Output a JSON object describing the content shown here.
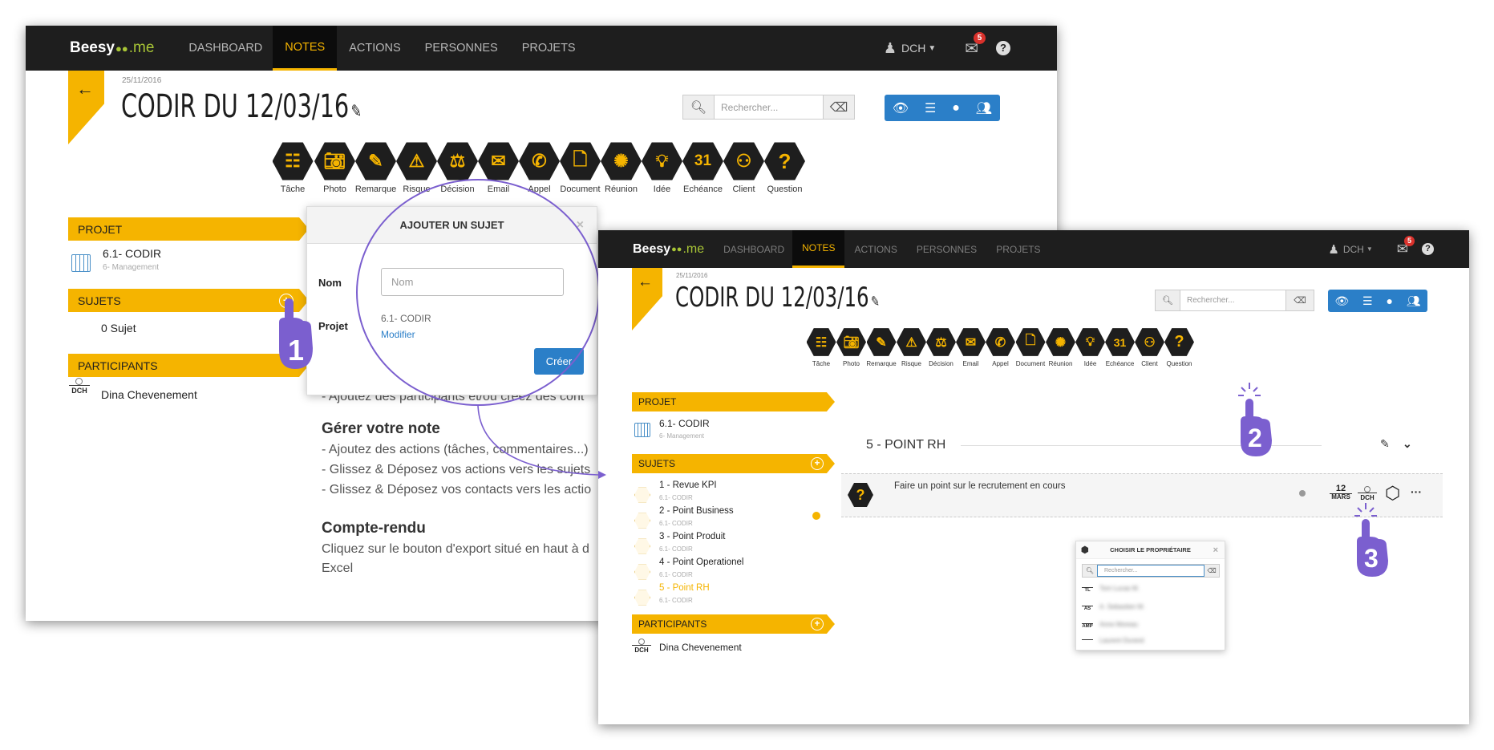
{
  "window1": {
    "logo": {
      "brand": "Beesy",
      "dots": "●●",
      "suffix": ".me"
    },
    "nav": [
      "DASHBOARD",
      "NOTES",
      "ACTIONS",
      "PERSONNES",
      "PROJETS"
    ],
    "active_nav": "NOTES",
    "user": "DCH",
    "mail_badge": "5",
    "date": "25/11/2016",
    "title": "CODIR DU 12/03/16",
    "search_placeholder": "Rechercher...",
    "tools": [
      "Tâche",
      "Photo",
      "Remarque",
      "Risque",
      "Décision",
      "Email",
      "Appel",
      "Document",
      "Réunion",
      "Idée",
      "Echéance",
      "Client",
      "Question"
    ],
    "sidebar": {
      "projet_header": "PROJET",
      "project_name": "6.1- CODIR",
      "project_sub": "6- Management",
      "sujets_header": "SUJETS",
      "sujets_count": "0 Sujet",
      "participants_header": "PARTICIPANTS",
      "participant_initials": "DCH",
      "participant_name": "Dina Chevenement"
    },
    "modal": {
      "title": "AJOUTER UN SUJET",
      "nom_label": "Nom",
      "nom_placeholder": "Nom",
      "projet_label": "Projet",
      "projet_value": "6.1- CODIR",
      "modifier": "Modifier",
      "creer": "Créer"
    },
    "help": {
      "line0": "- Ajoutez des participants et/ou créez des cont",
      "gerer_title": "Gérer votre note",
      "gerer_lines": [
        "- Ajoutez des actions (tâches, commentaires...)",
        "- Glissez & Déposez vos actions vers les sujets",
        "- Glissez & Déposez vos contacts vers les actio"
      ],
      "compte_title": "Compte-rendu",
      "compte_lines": [
        "Cliquez sur le bouton d'export situé en haut à d",
        "Excel"
      ]
    },
    "step": "1"
  },
  "window2": {
    "logo": {
      "brand": "Beesy",
      "dots": "●●",
      "suffix": ".me"
    },
    "nav": [
      "DASHBOARD",
      "NOTES",
      "ACTIONS",
      "PERSONNES",
      "PROJETS"
    ],
    "user": "DCH",
    "mail_badge": "5",
    "date": "25/11/2016",
    "title": "CODIR DU 12/03/16",
    "search_placeholder": "Rechercher...",
    "tools": [
      "Tâche",
      "Photo",
      "Remarque",
      "Risque",
      "Décision",
      "Email",
      "Appel",
      "Document",
      "Réunion",
      "Idée",
      "Echéance",
      "Client",
      "Question"
    ],
    "sidebar": {
      "projet_header": "PROJET",
      "project_name": "6.1- CODIR",
      "project_sub": "6- Management",
      "sujets_header": "SUJETS",
      "subjects": [
        {
          "name": "1 - Revue KPI",
          "sub": "6.1- CODIR"
        },
        {
          "name": "2 - Point Business",
          "sub": "6.1- CODIR"
        },
        {
          "name": "3 - Point Produit",
          "sub": "6.1- CODIR"
        },
        {
          "name": "4 - Point Operationel",
          "sub": "6.1- CODIR"
        },
        {
          "name": "5 - Point RH",
          "sub": "6.1- CODIR"
        }
      ],
      "participants_header": "PARTICIPANTS",
      "participant_initials": "DCH",
      "participant_name": "Dina Chevenement"
    },
    "section_title": "5 - POINT RH",
    "action_text": "Faire un point sur le recrutement en cours",
    "due_day": "12",
    "due_month": "MARS",
    "owner_initials": "DCH",
    "owner_popup": {
      "title": "CHOISIR LE PROPRIÉTAIRE",
      "search_placeholder": "Rechercher...",
      "people": [
        {
          "initials": "TL",
          "name": "Tom Lucas M."
        },
        {
          "initials": "AS",
          "name": "A. Sebastien M."
        },
        {
          "initials": "AMP",
          "name": "Anne Moreau"
        },
        {
          "initials": "",
          "name": "Laurent Durand"
        }
      ]
    },
    "steps": [
      "2",
      "3"
    ]
  },
  "colors": {
    "accent": "#f5b400",
    "nav_bg": "#1e1e1e",
    "blue": "#2b7fc8",
    "annotation": "#7b5fcf"
  }
}
